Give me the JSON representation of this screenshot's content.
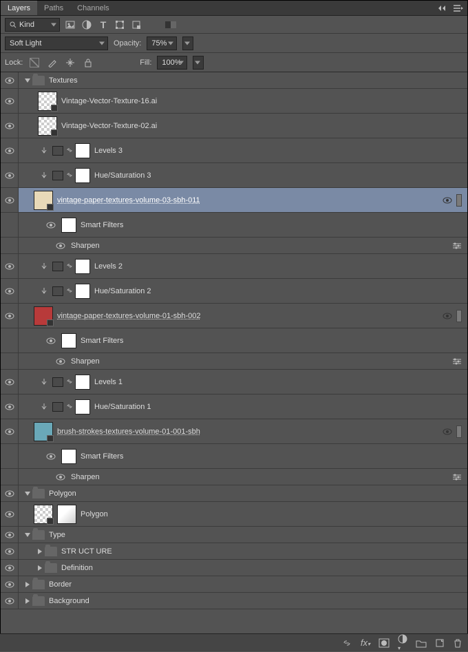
{
  "tabs": {
    "active": "Layers",
    "others": [
      "Paths",
      "Channels"
    ]
  },
  "filterLabel": "Kind",
  "blendMode": "Soft Light",
  "opacityLabel": "Opacity:",
  "opacityValue": "75%",
  "lockLabel": "Lock:",
  "fillLabel": "Fill:",
  "fillValue": "100%",
  "groups": {
    "textures": "Textures",
    "polygon": "Polygon",
    "type": "Type",
    "structure": "STR UCT URE",
    "definition": "Definition",
    "border": "Border",
    "background": "Background"
  },
  "layers": {
    "vvt16": "Vintage-Vector-Texture-16.ai",
    "vvt02": "Vintage-Vector-Texture-02.ai",
    "levels3": "Levels 3",
    "huesat3": "Hue/Saturation 3",
    "vpt03": "vintage-paper-textures-volume-03-sbh-011",
    "smartFilters": "Smart Filters",
    "sharpen": "Sharpen",
    "levels2": "Levels 2",
    "huesat2": "Hue/Saturation 2",
    "vpt01": "vintage-paper-textures-volume-01-sbh-002",
    "levels1": "Levels 1",
    "huesat1": "Hue/Saturation 1",
    "brush": "brush-strokes-textures-volume-01-001-sbh",
    "polygonLayer": "Polygon"
  }
}
